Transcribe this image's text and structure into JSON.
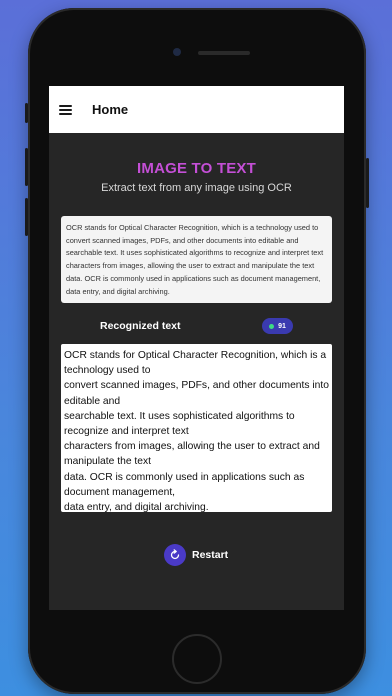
{
  "appbar": {
    "title": "Home"
  },
  "hero": {
    "title": "IMAGE TO TEXT",
    "subtitle": "Extract text from any image using OCR"
  },
  "preview": {
    "text": "OCR stands for Optical Character Recognition, which is a technology used to convert scanned images, PDFs, and other documents into editable and searchable text. It uses sophisticated algorithms to recognize and interpret text characters from images, allowing the user to extract and manipulate the text data. OCR is commonly used in applications such as document management, data entry, and digital archiving."
  },
  "recognized": {
    "label": "Recognized text",
    "score": "91",
    "score_dot_color": "#3ddc84",
    "badge_color": "#3a3ab0",
    "lines": [
      "OCR stands for Optical Character Recognition, which is a technology used to",
      "convert scanned images, PDFs, and other documents into editable and",
      "searchable text. It uses sophisticated algorithms to recognize and interpret text",
      "characters from images, allowing the user to extract and manipulate the text",
      "data. OCR is commonly used in applications such as document management,",
      "data entry, and digital archiving."
    ]
  },
  "actions": {
    "restart_label": "Restart",
    "restart_icon": "refresh-icon"
  },
  "colors": {
    "accent": "#c44fd6",
    "button": "#4a3ac7",
    "screen_bg": "#262626"
  }
}
